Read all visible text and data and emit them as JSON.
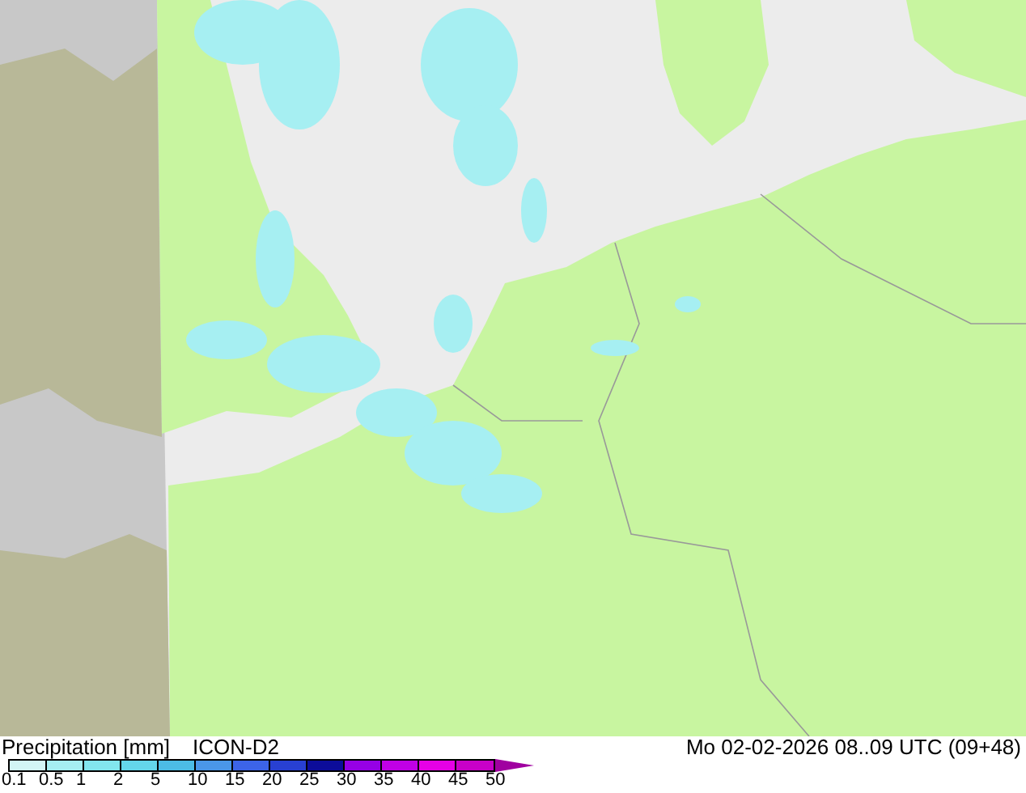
{
  "map": {
    "title": "Precipitation [mm]",
    "model": "ICON-D2",
    "valid_time": "Mo 02-02-2026 08..09 UTC (09+48)"
  },
  "legend": {
    "swatches": [
      {
        "label": "0.1",
        "color": "#d2f5f5"
      },
      {
        "label": "0.5",
        "color": "#a6eff2"
      },
      {
        "label": "1",
        "color": "#82e6ee"
      },
      {
        "label": "2",
        "color": "#64d6ea"
      },
      {
        "label": "5",
        "color": "#4cbce6"
      },
      {
        "label": "10",
        "color": "#4a96e8"
      },
      {
        "label": "15",
        "color": "#3c64e8"
      },
      {
        "label": "20",
        "color": "#2840d2"
      },
      {
        "label": "25",
        "color": "#0c0c9a"
      },
      {
        "label": "30",
        "color": "#9600e6"
      },
      {
        "label": "35",
        "color": "#c000e6"
      },
      {
        "label": "40",
        "color": "#e600e6"
      },
      {
        "label": "45",
        "color": "#c800c8"
      }
    ],
    "end_label": "50"
  }
}
